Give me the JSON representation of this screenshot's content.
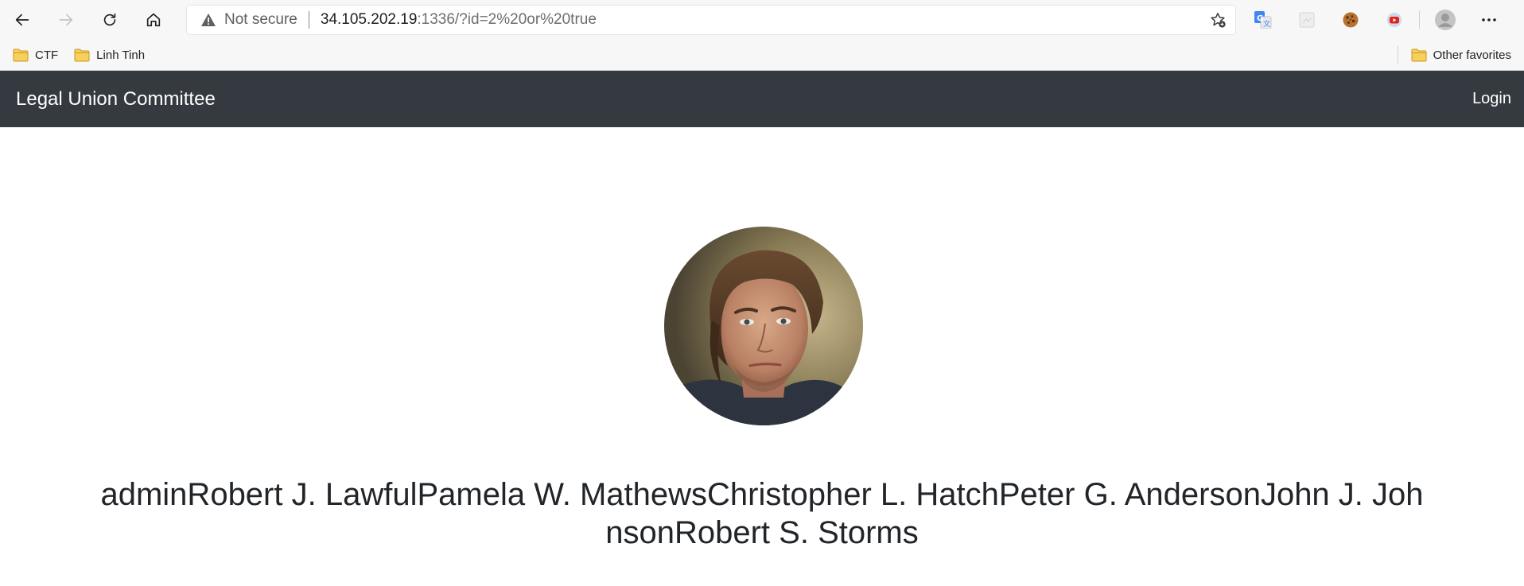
{
  "browser": {
    "address": {
      "security_label": "Not secure",
      "url_host": "34.105.202.19",
      "url_rest": ":1336/?id=2%20or%20true"
    },
    "bookmarks": [
      {
        "label": "CTF"
      },
      {
        "label": "Linh Tinh"
      }
    ],
    "other_favorites": "Other favorites",
    "extensions": [
      "google-translate-icon",
      "blank-extension-icon",
      "cookie-icon",
      "youtube-icon"
    ],
    "icons": {
      "back": "arrow-left-icon",
      "forward": "arrow-right-icon",
      "reload": "reload-icon",
      "home": "home-icon",
      "warning": "warning-icon",
      "favorite": "star-add-icon",
      "profile": "profile-icon",
      "menu": "more-icon",
      "folder": "folder-icon"
    }
  },
  "site": {
    "brand": "Legal Union Committee",
    "login": "Login",
    "nav_color": "#343a40"
  },
  "profile": {
    "names": "adminRobert J. LawfulPamela W. MathewsChristopher L. HatchPeter G. AndersonJohn J. JohnsonRobert S. Storms"
  }
}
